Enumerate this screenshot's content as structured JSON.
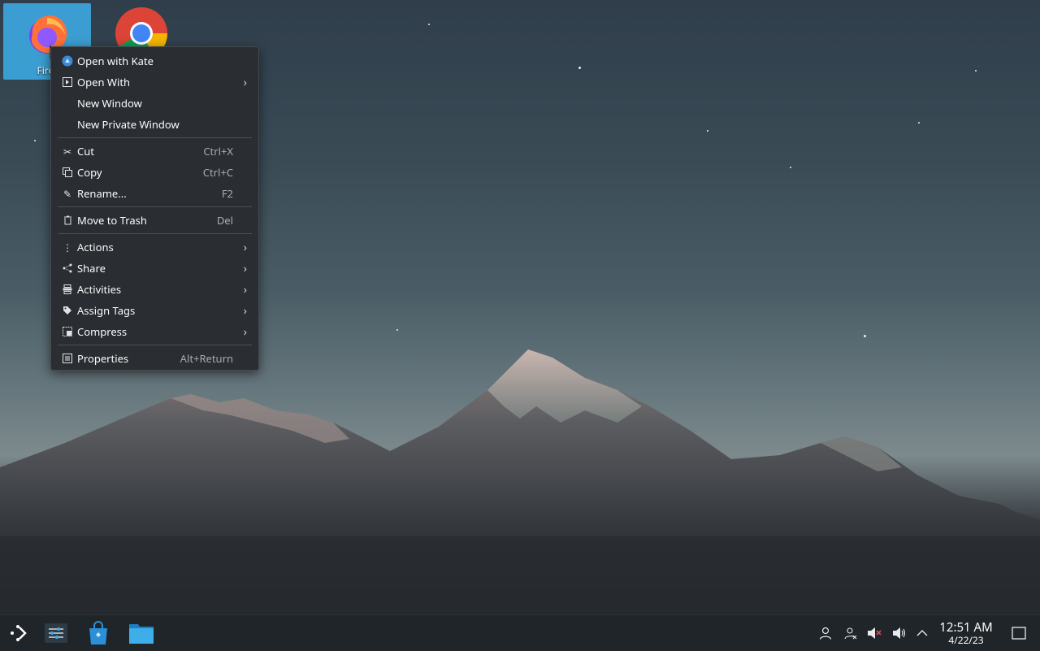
{
  "desktop": {
    "icons": [
      {
        "label": "Firef"
      },
      {
        "label": ""
      }
    ]
  },
  "context_menu": {
    "items": [
      {
        "label": "Open with Kate",
        "shortcut": "",
        "icon": "kate-icon",
        "submenu": false
      },
      {
        "label": "Open With",
        "shortcut": "",
        "icon": "open-with-icon",
        "submenu": true
      },
      {
        "label": "New Window",
        "shortcut": "",
        "icon": "",
        "submenu": false
      },
      {
        "label": "New Private Window",
        "shortcut": "",
        "icon": "",
        "submenu": false
      },
      {
        "label": "Cut",
        "shortcut": "Ctrl+X",
        "icon": "scissors-icon",
        "submenu": false
      },
      {
        "label": "Copy",
        "shortcut": "Ctrl+C",
        "icon": "copy-icon",
        "submenu": false
      },
      {
        "label": "Rename...",
        "shortcut": "F2",
        "icon": "pencil-icon",
        "submenu": false
      },
      {
        "label": "Move to Trash",
        "shortcut": "Del",
        "icon": "trash-icon",
        "submenu": false
      },
      {
        "label": "Actions",
        "shortcut": "",
        "icon": "kebab-icon",
        "submenu": true
      },
      {
        "label": "Share",
        "shortcut": "",
        "icon": "share-icon",
        "submenu": true
      },
      {
        "label": "Activities",
        "shortcut": "",
        "icon": "activities-icon",
        "submenu": true
      },
      {
        "label": "Assign Tags",
        "shortcut": "",
        "icon": "tag-icon",
        "submenu": true
      },
      {
        "label": "Compress",
        "shortcut": "",
        "icon": "compress-icon",
        "submenu": true
      },
      {
        "label": "Properties",
        "shortcut": "Alt+Return",
        "icon": "properties-icon",
        "submenu": false
      }
    ]
  },
  "taskbar": {
    "clock_time": "12:51 AM",
    "clock_date": "4/22/23",
    "tray_icons": [
      "user-icon",
      "user-switch-icon",
      "volume-muted-icon",
      "volume-icon",
      "chevron-up-icon",
      "show-desktop-icon"
    ]
  },
  "colors": {
    "menu_bg": "#2a2e32",
    "taskbar_bg": "#20252a",
    "selection": "#3daee9"
  }
}
